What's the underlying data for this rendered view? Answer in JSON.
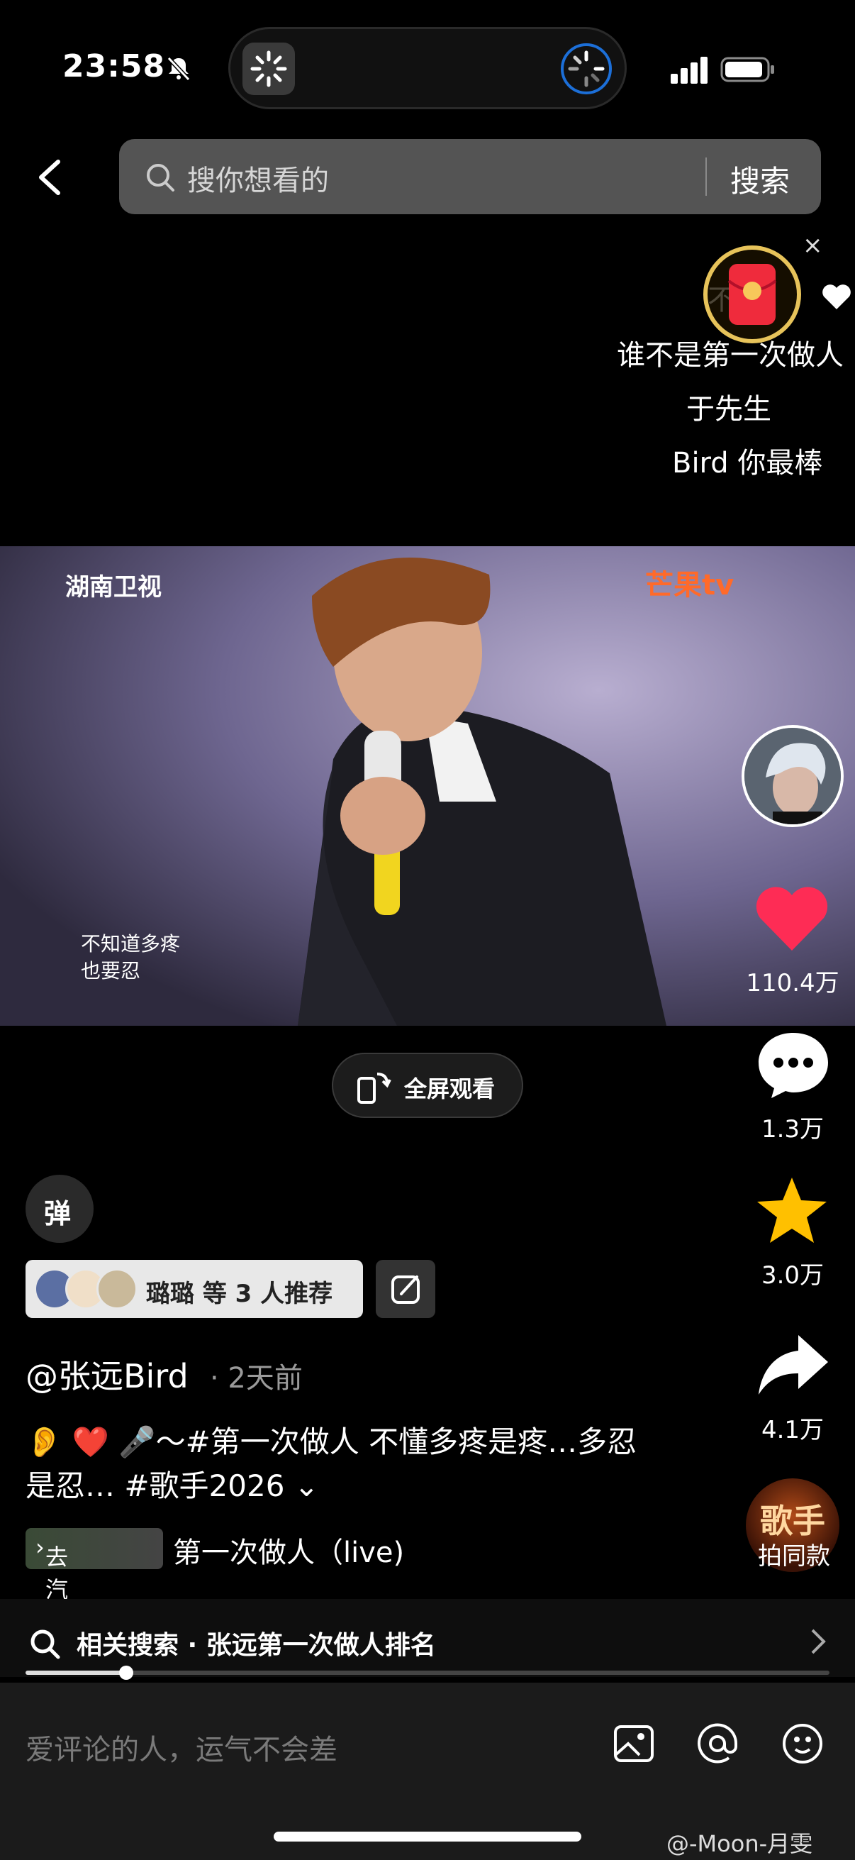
{
  "status_bar": {
    "time": "23:58"
  },
  "search": {
    "placeholder": "搜你想看的",
    "button": "搜索"
  },
  "danmaku_overlay": {
    "close": "×",
    "comments": [
      "不悦",
      "谁不是第一次做人",
      "于先生",
      "Bird 你最棒"
    ]
  },
  "video": {
    "channel_logo": "湖南卫视",
    "platform_logo": "芒果tv",
    "subtitle_lines": [
      "不知道多疼",
      "也要忍"
    ]
  },
  "actions": {
    "likes": "110.4万",
    "comments": "1.3万",
    "favorites": "3.0万",
    "shares": "4.1万",
    "singer_badge": "歌手",
    "shoot_same": "拍同款"
  },
  "fullscreen_label": "全屏观看",
  "danmaku_toggle": "弹",
  "recommend": {
    "text": "璐璐 等 3 人推荐"
  },
  "post": {
    "author": "@张远Bird",
    "posted": "· 2天前",
    "description": "👂 ❤️ 🎤～#第一次做人 不懂多疼是疼…多忍是忍… #歌手2026",
    "expand": "⌄",
    "listen_label": "去汽水听",
    "song": "第一次做人（live)"
  },
  "related_search": {
    "text": "相关搜索 · 张远第一次做人排名"
  },
  "comment_bar": {
    "placeholder": "爱评论的人，运气不会差"
  },
  "watermark": "@-Moon-月雯",
  "colors": {
    "like": "#fe2c55",
    "star": "#ffc000",
    "mango": "#ff6a2a"
  }
}
